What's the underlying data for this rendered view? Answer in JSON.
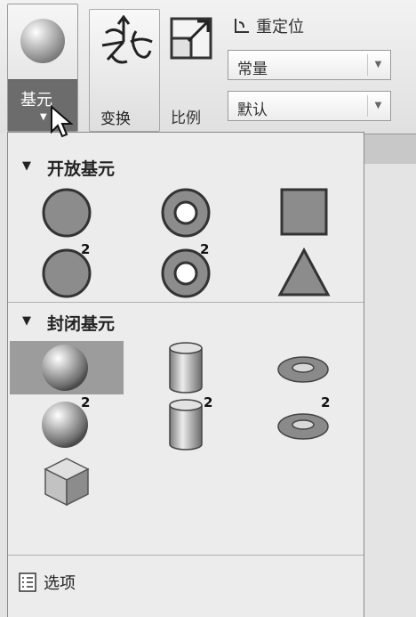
{
  "ribbon": {
    "primitive_button": {
      "label": "基元",
      "icon": "sphere-icon",
      "dropdown_icon": "triangle-down-icon"
    },
    "transform_button": {
      "label": "变换",
      "icon": "transform-icon"
    },
    "scale": {
      "label": "比例",
      "icon": "scale-icon"
    },
    "relocate": {
      "label": "重定位",
      "icon": "relocate-icon"
    },
    "constant_combo": {
      "value": "常量",
      "icon": "chevron-down-icon"
    },
    "default_combo": {
      "value": "默认",
      "icon": "chevron-down-icon"
    }
  },
  "panel": {
    "open_section": {
      "title": "开放基元",
      "items": [
        {
          "icon": "open-circle-icon",
          "badge": ""
        },
        {
          "icon": "open-ring-icon",
          "badge": ""
        },
        {
          "icon": "open-square-icon",
          "badge": ""
        },
        {
          "icon": "open-circle-2-icon",
          "badge": "2"
        },
        {
          "icon": "open-ring-2-icon",
          "badge": "2"
        },
        {
          "icon": "open-triangle-icon",
          "badge": ""
        }
      ]
    },
    "closed_section": {
      "title": "封闭基元",
      "items": [
        {
          "icon": "sphere-icon",
          "badge": "",
          "selected": true
        },
        {
          "icon": "cylinder-icon",
          "badge": ""
        },
        {
          "icon": "torus-icon",
          "badge": ""
        },
        {
          "icon": "sphere-2-icon",
          "badge": "2"
        },
        {
          "icon": "cylinder-2-icon",
          "badge": "2"
        },
        {
          "icon": "torus-2-icon",
          "badge": "2"
        },
        {
          "icon": "cube-icon",
          "badge": ""
        }
      ]
    },
    "options": {
      "label": "选项",
      "icon": "options-list-icon"
    }
  }
}
